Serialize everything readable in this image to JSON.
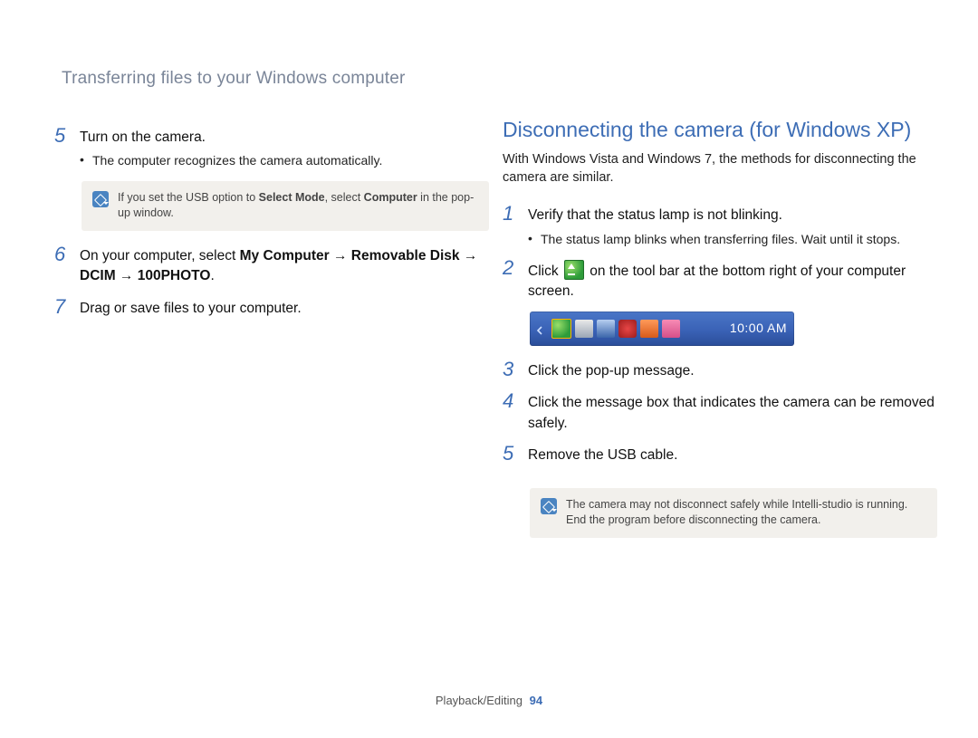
{
  "header": "Transferring files to your Windows computer",
  "left": {
    "steps": [
      {
        "n": "5",
        "text": "Turn on the camera.",
        "sub": [
          "The computer recognizes the camera automatically."
        ]
      },
      {
        "n": "6",
        "html": "On your computer, select <strong>My Computer</strong> → <strong>Removable Disk</strong> → <strong>DCIM</strong> → <strong>100PHOTO</strong>."
      },
      {
        "n": "7",
        "text": "Drag or save files to your computer."
      }
    ],
    "note_html": "If you set the USB option to <strong>Select Mode</strong>, select <strong>Computer</strong> in the pop-up window."
  },
  "right": {
    "title": "Disconnecting the camera (for Windows XP)",
    "intro": "With Windows Vista and Windows 7, the methods for disconnecting the camera are similar.",
    "steps": [
      {
        "n": "1",
        "text": "Verify that the status lamp is not blinking.",
        "sub": [
          "The status lamp blinks when transferring files. Wait until it stops."
        ]
      },
      {
        "n": "2",
        "html": "Click <span class=\"inline-eject\" data-name=\"safely-remove-hardware-icon\" data-interactable=\"false\"></span> on the tool bar at the bottom right of your computer screen."
      },
      {
        "n": "3",
        "text": "Click the pop-up message."
      },
      {
        "n": "4",
        "text": "Click the message box that indicates the camera can be removed safely."
      },
      {
        "n": "5",
        "text": "Remove the USB cable."
      }
    ],
    "note": "The camera may not disconnect safely while Intelli-studio is running. End the program before disconnecting the camera.",
    "taskbar_clock": "10:00 AM"
  },
  "footer": {
    "section": "Playback/Editing",
    "page": "94"
  }
}
